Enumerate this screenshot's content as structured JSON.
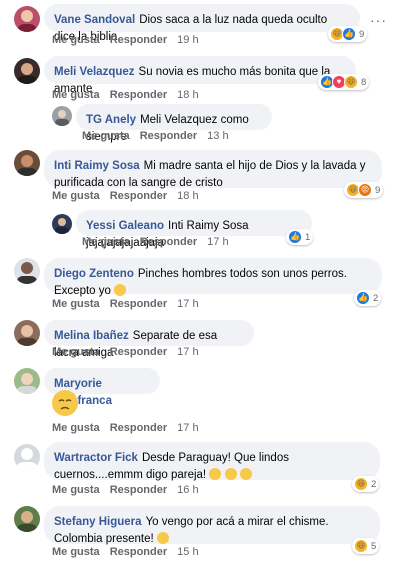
{
  "actions": {
    "like": "Me gusta",
    "reply": "Responder"
  },
  "comments": [
    {
      "author": "Vane Sandoval",
      "text": "Dios saca a la luz nada queda oculto dice la biblia",
      "time": "19 h",
      "reactions": "9"
    },
    {
      "author": "Meli Velazquez",
      "text": "Su novia es mucho más bonita que la amante",
      "time": "18 h",
      "reactions": "8"
    },
    {
      "author": "TG Anely",
      "text": "Meli Velazquez como siempre",
      "time": "13 h"
    },
    {
      "author": "Inti Raimy Sosa",
      "text": "Mi madre santa el hijo de Dios y la lavada y purificada con la sangre de cristo",
      "time": "18 h",
      "reactions": "9"
    },
    {
      "author": "Yessi Galeano",
      "text": "Inti Raimy Sosa jajajajajajaajaja",
      "time": "17 h",
      "reactions": "1"
    },
    {
      "author": "Diego Zenteno",
      "text": "Pinches hombres todos son unos perros. Excepto yo",
      "time": "17 h",
      "reactions": "2"
    },
    {
      "author": "Melina Ibañez",
      "text": "Separate de esa lacra amiga",
      "time": "17 h"
    },
    {
      "author": "Maryorie Villafranca",
      "text": "",
      "time": "17 h"
    },
    {
      "author": "Wartractor Fick",
      "text": "Desde Paraguay! Que lindos cuernos....emmm digo pareja!",
      "time": "16 h",
      "reactions": "2"
    },
    {
      "author": "Stefany Higuera",
      "text": "Yo vengo por acá a mirar el chisme. Colombia presente!",
      "time": "15 h",
      "reactions": "5"
    }
  ],
  "colors": {
    "author": "#385898",
    "bubble": "#f0f2f5",
    "meta": "#65676b",
    "like": "#1877f2"
  }
}
